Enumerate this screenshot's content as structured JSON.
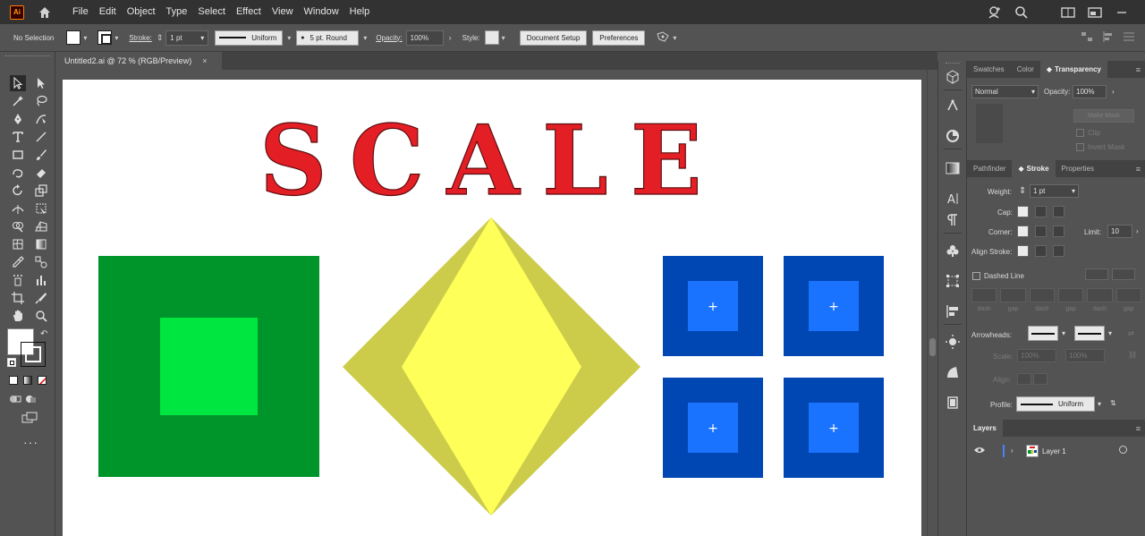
{
  "menubar": {
    "app_logo": "Ai",
    "items": [
      "File",
      "Edit",
      "Object",
      "Type",
      "Select",
      "Effect",
      "View",
      "Window",
      "Help"
    ]
  },
  "controlbar": {
    "selection": "No Selection",
    "stroke_label": "Stroke:",
    "stroke_value": "1 pt",
    "profile": "Uniform",
    "brush": "5 pt. Round",
    "opacity_label": "Opacity:",
    "opacity_value": "100%",
    "style_label": "Style:",
    "document_setup": "Document Setup",
    "preferences": "Preferences"
  },
  "document": {
    "tab_title": "Untitled2.ai @ 72 % (RGB/Preview)",
    "close": "×"
  },
  "artwork": {
    "title_text": "SCALE",
    "title_color": "#e31e24",
    "green_outer": "#00952b",
    "green_inner": "#00e640",
    "yellow_dark": "#cccc4a",
    "yellow_light": "#ffff5a",
    "blue_outer": "#0047b3",
    "blue_inner": "#1a73ff"
  },
  "transparency_panel": {
    "tabs": [
      "Swatches",
      "Color",
      "Transparency"
    ],
    "blend_mode": "Normal",
    "opacity_label": "Opacity:",
    "opacity_value": "100%",
    "make_mask": "Make Mask",
    "clip": "Clip",
    "invert_mask": "Invert Mask"
  },
  "stroke_panel": {
    "tabs": [
      "Pathfinder",
      "Stroke",
      "Properties"
    ],
    "weight_label": "Weight:",
    "weight_value": "1 pt",
    "cap_label": "Cap:",
    "corner_label": "Corner:",
    "limit_label": "Limit:",
    "limit_value": "10",
    "align_label": "Align Stroke:",
    "dashed_label": "Dashed Line",
    "dash_gap": [
      "dash",
      "gap",
      "dash",
      "gap",
      "dash",
      "gap"
    ],
    "arrowheads_label": "Arrowheads:",
    "scale_label": "Scale:",
    "scale_values": [
      "100%",
      "100%"
    ],
    "align_arrow_label": "Align:",
    "profile_label": "Profile:",
    "profile_value": "Uniform"
  },
  "layers_panel": {
    "title": "Layers",
    "layer_name": "Layer 1"
  }
}
